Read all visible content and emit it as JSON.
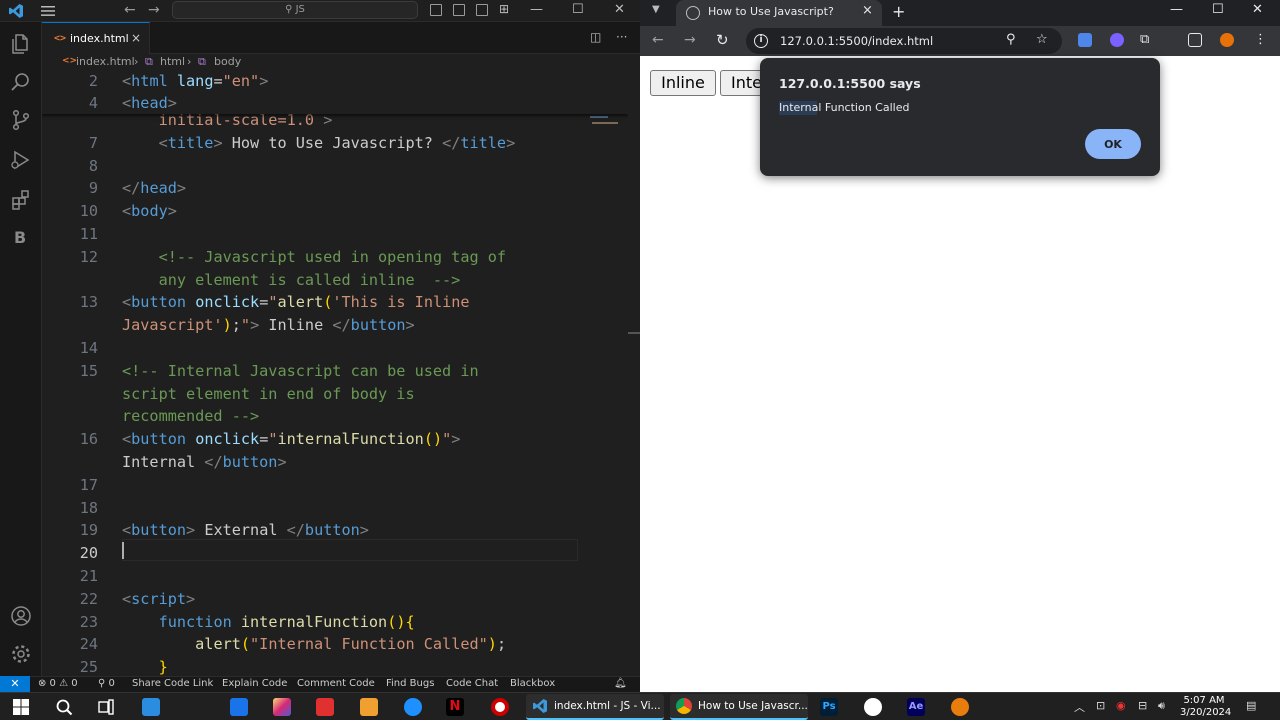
{
  "vscode": {
    "search_placeholder": "JS",
    "tab": {
      "label": "index.html",
      "close": "×"
    },
    "breadcrumb": [
      "index.html",
      "html",
      "body"
    ],
    "sticky_lines": [
      {
        "n": "2",
        "segs": [
          [
            "t-brk",
            "<"
          ],
          [
            "t-tag",
            "html"
          ],
          [
            "t-pl",
            " "
          ],
          [
            "t-attr",
            "lang"
          ],
          [
            "t-pl",
            "="
          ],
          [
            "t-str",
            "\"en\""
          ],
          [
            "t-brk",
            ">"
          ]
        ]
      },
      {
        "n": "4",
        "segs": [
          [
            "t-brk",
            "<"
          ],
          [
            "t-tag",
            "head"
          ],
          [
            "t-brk",
            ">"
          ]
        ]
      }
    ],
    "lines": [
      {
        "n": "",
        "segs": [
          [
            "t-pl",
            "    "
          ],
          [
            "t-str",
            "initial-scale=1.0"
          ],
          [
            "t-pl",
            " "
          ],
          [
            "t-brk",
            ">"
          ]
        ]
      },
      {
        "n": "7",
        "segs": [
          [
            "t-pl",
            "    "
          ],
          [
            "t-brk",
            "<"
          ],
          [
            "t-tag",
            "title"
          ],
          [
            "t-brk",
            ">"
          ],
          [
            "t-pl",
            " How to Use Javascript? "
          ],
          [
            "t-brk",
            "</"
          ],
          [
            "t-tag",
            "title"
          ],
          [
            "t-brk",
            ">"
          ]
        ]
      },
      {
        "n": "8",
        "segs": []
      },
      {
        "n": "9",
        "segs": [
          [
            "t-brk",
            "</"
          ],
          [
            "t-tag",
            "head"
          ],
          [
            "t-brk",
            ">"
          ]
        ]
      },
      {
        "n": "10",
        "segs": [
          [
            "t-brk",
            "<"
          ],
          [
            "t-tag",
            "body"
          ],
          [
            "t-brk",
            ">"
          ]
        ]
      },
      {
        "n": "11",
        "segs": []
      },
      {
        "n": "12",
        "segs": [
          [
            "t-pl",
            "    "
          ],
          [
            "t-com",
            "<!-- Javascript used in opening tag of"
          ]
        ]
      },
      {
        "n": "",
        "segs": [
          [
            "t-pl",
            "    "
          ],
          [
            "t-com",
            "any element is called inline  -->"
          ]
        ]
      },
      {
        "n": "13",
        "segs": [
          [
            "t-brk",
            "<"
          ],
          [
            "t-tag",
            "button"
          ],
          [
            "t-pl",
            " "
          ],
          [
            "t-attr",
            "onclick"
          ],
          [
            "t-pl",
            "="
          ],
          [
            "t-str",
            "\""
          ],
          [
            "t-fn",
            "alert"
          ],
          [
            "t-br",
            "("
          ],
          [
            "t-str",
            "'This is Inline"
          ]
        ]
      },
      {
        "n": "",
        "segs": [
          [
            "t-str",
            "Javascript'"
          ],
          [
            "t-br",
            ")"
          ],
          [
            "t-pl",
            ";"
          ],
          [
            "t-str",
            "\""
          ],
          [
            "t-brk",
            ">"
          ],
          [
            "t-pl",
            " Inline "
          ],
          [
            "t-brk",
            "</"
          ],
          [
            "t-tag",
            "button"
          ],
          [
            "t-brk",
            ">"
          ]
        ]
      },
      {
        "n": "14",
        "segs": []
      },
      {
        "n": "15",
        "segs": [
          [
            "t-com",
            "<!-- Internal Javascript can be used in"
          ]
        ]
      },
      {
        "n": "",
        "segs": [
          [
            "t-com",
            "script element in end of body is"
          ]
        ]
      },
      {
        "n": "",
        "segs": [
          [
            "t-com",
            "recommended -->"
          ]
        ]
      },
      {
        "n": "16",
        "segs": [
          [
            "t-brk",
            "<"
          ],
          [
            "t-tag",
            "button"
          ],
          [
            "t-pl",
            " "
          ],
          [
            "t-attr",
            "onclick"
          ],
          [
            "t-pl",
            "="
          ],
          [
            "t-str",
            "\""
          ],
          [
            "t-fn",
            "internalFunction"
          ],
          [
            "t-br",
            "()"
          ],
          [
            "t-str",
            "\""
          ],
          [
            "t-brk",
            ">"
          ]
        ]
      },
      {
        "n": "",
        "segs": [
          [
            "t-pl",
            "Internal "
          ],
          [
            "t-brk",
            "</"
          ],
          [
            "t-tag",
            "button"
          ],
          [
            "t-brk",
            ">"
          ]
        ]
      },
      {
        "n": "17",
        "segs": []
      },
      {
        "n": "18",
        "segs": []
      },
      {
        "n": "19",
        "segs": [
          [
            "t-brk",
            "<"
          ],
          [
            "t-tag",
            "button"
          ],
          [
            "t-brk",
            ">"
          ],
          [
            "t-pl",
            " External "
          ],
          [
            "t-brk",
            "</"
          ],
          [
            "t-tag",
            "button"
          ],
          [
            "t-brk",
            ">"
          ]
        ]
      },
      {
        "n": "20",
        "segs": [],
        "active": true
      },
      {
        "n": "21",
        "segs": []
      },
      {
        "n": "22",
        "segs": [
          [
            "t-brk",
            "<"
          ],
          [
            "t-tag",
            "script"
          ],
          [
            "t-brk",
            ">"
          ]
        ]
      },
      {
        "n": "23",
        "segs": [
          [
            "t-pl",
            "    "
          ],
          [
            "t-kw",
            "function"
          ],
          [
            "t-pl",
            " "
          ],
          [
            "t-fn",
            "internalFunction"
          ],
          [
            "t-br",
            "(){"
          ]
        ]
      },
      {
        "n": "24",
        "segs": [
          [
            "t-pl",
            "        "
          ],
          [
            "t-fn",
            "alert"
          ],
          [
            "t-br",
            "("
          ],
          [
            "t-str",
            "\"Internal Function Called\""
          ],
          [
            "t-br",
            ")"
          ],
          [
            "t-pl",
            ";"
          ]
        ]
      },
      {
        "n": "25",
        "segs": [
          [
            "t-pl",
            "    "
          ],
          [
            "t-br",
            "}"
          ]
        ]
      }
    ],
    "status": {
      "remote": "✕",
      "problems": "⊗ 0 ⚠ 0",
      "ports": "⚲ 0",
      "items": [
        "Share Code Link",
        "Explain Code",
        "Comment Code",
        "Find Bugs",
        "Code Chat",
        "Blackbox"
      ]
    }
  },
  "chrome": {
    "tab_title": "How to Use Javascript?",
    "tab_close": "×",
    "new_tab": "+",
    "url": "127.0.0.1:5500/index.html",
    "page_buttons": [
      "Inline",
      "Inte"
    ],
    "dialog": {
      "title": "127.0.0.1:5500 says",
      "message": "Internal Function Called",
      "ok_label": "OK"
    }
  },
  "taskbar": {
    "apps": [
      {
        "label": "index.html - JS - Vi..."
      },
      {
        "label": "How to Use Javascr..."
      }
    ],
    "time": "5:07 AM",
    "date": "3/20/2024",
    "ps_label": "Ps",
    "ae_label": "Ae"
  },
  "colors": {
    "accent": "#0078d4",
    "dialog_ok": "#8ab4f8",
    "taskbar_active": "#4cc2ff"
  }
}
